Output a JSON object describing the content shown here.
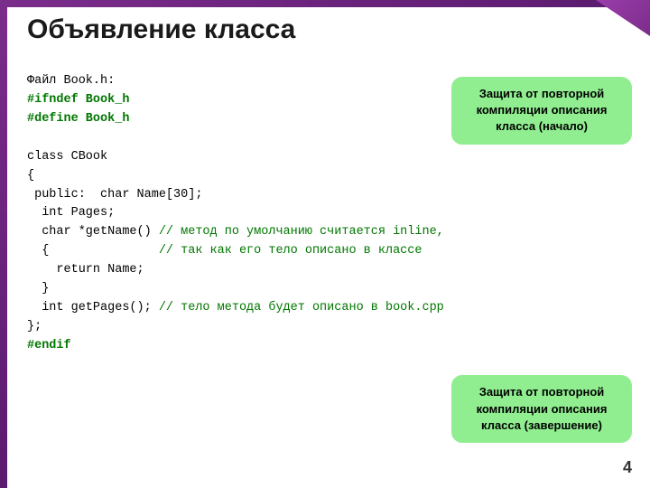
{
  "slide": {
    "title": "Объявление класса",
    "page_number": "4"
  },
  "callout_top": {
    "text": "Защита от повторной компиляции описания класса (начало)"
  },
  "callout_bottom": {
    "text": "Защита от повторной компиляции описания класса (завершение)"
  },
  "code": {
    "file_label": "Файл Book.h:",
    "lines": [
      "#ifndef Book_h",
      "#define Book_h",
      "",
      "class CBook",
      "{",
      " public:  char Name[30];",
      "  int Pages;",
      "  char *getName() // метод по умолчанию считается inline,",
      "  {               // так как его тело описано в классе",
      "    return Name;",
      "  }",
      "  int getPages(); // тело метода будет описано в book.cpp",
      "};",
      "#endif"
    ]
  }
}
